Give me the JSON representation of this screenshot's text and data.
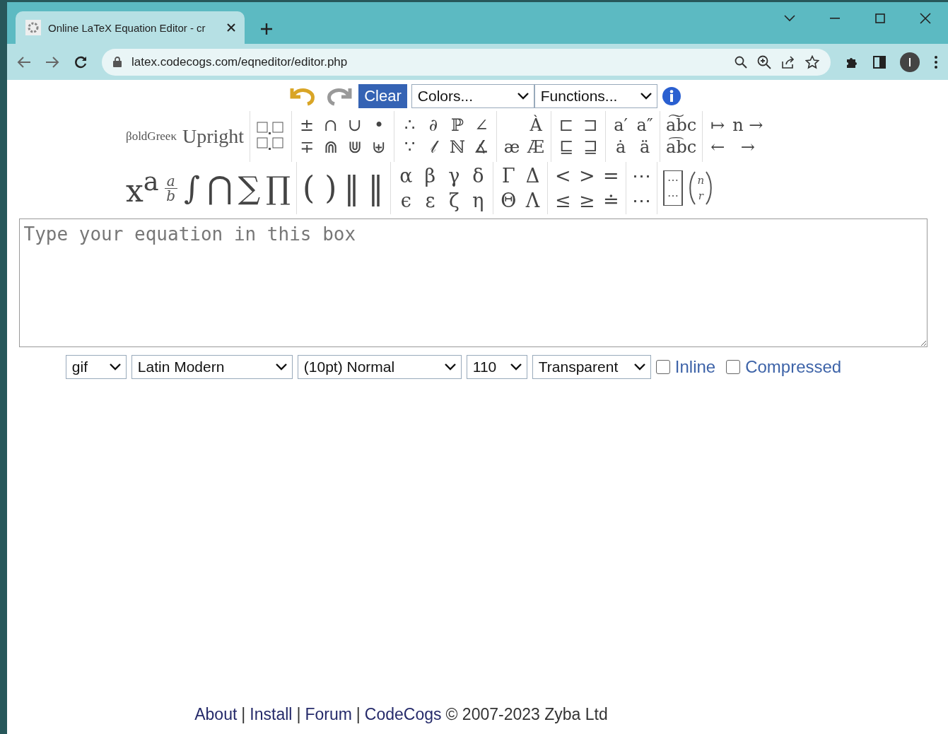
{
  "browser": {
    "tab_title": "Online LaTeX Equation Editor - cr",
    "address": "latex.codecogs.com/eqneditor/editor.php"
  },
  "toolbar": {
    "clear": "Clear",
    "colors": "Colors...",
    "functions": "Functions..."
  },
  "palette_top": [
    {
      "kind": "labels",
      "items": [
        "βoldGreeκ",
        "Upright"
      ]
    },
    {
      "kind": "boxes"
    },
    {
      "kind": "grid",
      "rows": [
        [
          "±",
          "∩",
          "∪",
          "•"
        ],
        [
          "∓",
          "⋒",
          "⋓",
          "⊎"
        ]
      ]
    },
    {
      "kind": "grid",
      "rows": [
        [
          "∴",
          "∂",
          "ℙ",
          "∠"
        ],
        [
          "∵",
          "𝓁",
          "ℕ",
          "∡"
        ]
      ]
    },
    {
      "kind": "grid",
      "rows": [
        [
          "",
          "À"
        ],
        [
          "æ",
          "Æ"
        ]
      ]
    },
    {
      "kind": "grid",
      "rows": [
        [
          "⊏",
          "⊐"
        ],
        [
          "⊑",
          "⊒"
        ]
      ]
    },
    {
      "kind": "grid",
      "rows": [
        [
          "a′",
          "a″"
        ],
        [
          "ȧ",
          "ä"
        ]
      ]
    },
    {
      "kind": "grid",
      "rows": [
        [
          "a͠bc"
        ],
        [
          "a͡bc"
        ]
      ]
    },
    {
      "kind": "grid",
      "rows": [
        [
          "↦",
          "n →"
        ],
        [
          "←",
          "→"
        ]
      ]
    }
  ],
  "palette_bottom": [
    {
      "kind": "big",
      "items": [
        {
          "kind": "text",
          "text": "x$^{a}$"
        },
        {
          "kind": "frac",
          "num": "a",
          "den": "b"
        },
        {
          "kind": "text",
          "text": "∫"
        },
        {
          "kind": "text",
          "text": "⋂"
        },
        {
          "kind": "text",
          "text": "∑"
        },
        {
          "kind": "text",
          "text": "∏"
        }
      ]
    },
    {
      "kind": "big",
      "items": [
        {
          "kind": "text",
          "text": "( )"
        },
        {
          "kind": "text",
          "text": "‖"
        },
        {
          "kind": "text",
          "text": "‖"
        }
      ]
    },
    {
      "kind": "grid",
      "rows": [
        [
          "α",
          "β",
          "γ",
          "δ"
        ],
        [
          "ϵ",
          "ε",
          "ζ",
          "η"
        ]
      ]
    },
    {
      "kind": "grid",
      "rows": [
        [
          "Γ",
          "Δ"
        ],
        [
          "Θ",
          "Λ"
        ]
      ]
    },
    {
      "kind": "grid",
      "rows": [
        [
          "<",
          ">",
          "="
        ],
        [
          "≤",
          "≥",
          "≐"
        ]
      ]
    },
    {
      "kind": "grid",
      "rows": [
        [
          "⋯"
        ],
        [
          "⋯"
        ]
      ]
    },
    {
      "kind": "big",
      "items": [
        {
          "kind": "matrix",
          "rows": [
            "⋯",
            "⋯"
          ]
        },
        {
          "kind": "binom",
          "top": "n",
          "bottom": "r"
        }
      ]
    }
  ],
  "editor": {
    "placeholder": "Type your equation in this box"
  },
  "options": {
    "selects": [
      "gif",
      "Latin Modern",
      "(10pt) Normal",
      "110",
      "Transparent"
    ],
    "checks": [
      {
        "label": "Inline",
        "checked": false
      },
      {
        "label": "Compressed",
        "checked": false
      }
    ]
  },
  "footer": {
    "links": [
      "About",
      "Install",
      "Forum",
      "CodeCogs"
    ],
    "separators": [
      "|",
      "|",
      "|"
    ],
    "copyright": "© 2007-2023 Zyba Ltd"
  }
}
